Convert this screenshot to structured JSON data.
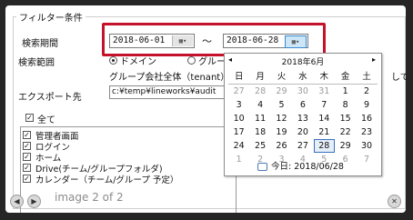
{
  "group": {
    "title": "フィルター条件"
  },
  "period": {
    "label": "検索期間",
    "start": "2018-06-01",
    "separator": "〜",
    "end": "2018-06-28"
  },
  "scope": {
    "label": "検索範囲",
    "option1": "ドメイン",
    "option2": "グループ",
    "tenant_text": "グループ会社全体（tenant）を",
    "tail_text": "して"
  },
  "export": {
    "label": "エクスポート先",
    "path": "c:¥temp¥lineworks¥audit"
  },
  "all_checkbox": {
    "label": "全て",
    "checked": true
  },
  "list_items": [
    {
      "label": "管理者画面",
      "checked": true
    },
    {
      "label": "ログイン",
      "checked": true
    },
    {
      "label": "ホーム",
      "checked": true
    },
    {
      "label": "Drive(チーム/グループフォルダ)",
      "checked": true
    },
    {
      "label": "カレンダー（チーム/グループ 予定）",
      "checked": true
    }
  ],
  "calendar": {
    "title": "2018年6月",
    "prev": "◂",
    "next": "▸",
    "weekdays": [
      "日",
      "月",
      "火",
      "水",
      "木",
      "金",
      "土"
    ],
    "weeks": [
      [
        "27",
        "28",
        "29",
        "30",
        "31",
        "1",
        "2"
      ],
      [
        "3",
        "4",
        "5",
        "6",
        "7",
        "8",
        "9"
      ],
      [
        "10",
        "11",
        "12",
        "13",
        "14",
        "15",
        "16"
      ],
      [
        "17",
        "18",
        "19",
        "20",
        "21",
        "22",
        "23"
      ],
      [
        "24",
        "25",
        "26",
        "27",
        "28",
        "29",
        "30"
      ],
      [
        "1",
        "2",
        "3",
        "4",
        "5",
        "6",
        "7"
      ]
    ],
    "today_label": "今日: 2018/06/28"
  },
  "viewer": {
    "caption": "image 2 of 2",
    "prev_icon": "arrow-left-icon",
    "next_icon": "arrow-right-icon",
    "close_icon": "close-icon"
  }
}
